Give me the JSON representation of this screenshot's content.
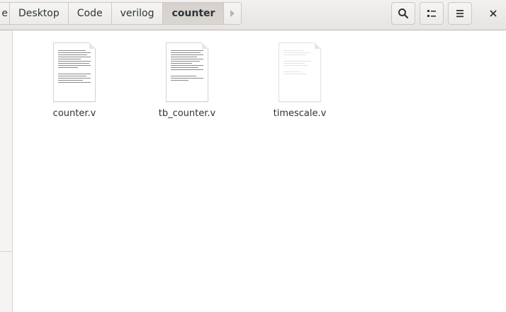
{
  "pathbar": {
    "crumbs": [
      {
        "label": "e"
      },
      {
        "label": "Desktop"
      },
      {
        "label": "Code"
      },
      {
        "label": "verilog"
      },
      {
        "label": "counter"
      }
    ]
  },
  "toolbar": {
    "search_icon": "search-icon",
    "view_icon": "list-view-icon",
    "menu_icon": "hamburger-menu-icon",
    "close_icon": "close-icon"
  },
  "files": [
    {
      "name": "counter.v"
    },
    {
      "name": "tb_counter.v"
    },
    {
      "name": "timescale.v"
    }
  ],
  "colors": {
    "headerbar": "#e8e6e3",
    "active_crumb": "#d8d4d0",
    "text": "#2e3436"
  }
}
